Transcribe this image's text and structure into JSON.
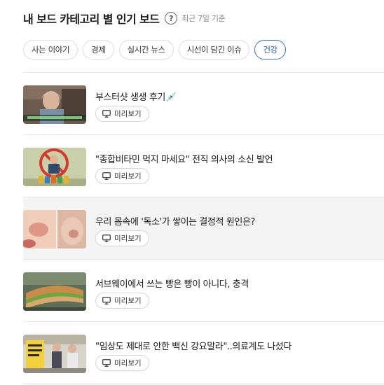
{
  "header": {
    "title": "내 보드 카테고리 별 인기 보드",
    "help_glyph": "?",
    "subtitle": "최근 7일 기준"
  },
  "tabs": [
    {
      "label": "사는 이야기",
      "active": false
    },
    {
      "label": "경제",
      "active": false
    },
    {
      "label": "실시간 뉴스",
      "active": false
    },
    {
      "label": "시선이 담긴 이슈",
      "active": false
    },
    {
      "label": "건강",
      "active": true
    }
  ],
  "items": [
    {
      "title": "부스터샷 생생 후기💉",
      "preview_label": "미리보기",
      "thumb_icon": "elderly-woman-tv-thumbnail"
    },
    {
      "title": "\"종합비타민 먹지 마세요\" 전직 의사의 소신 발언",
      "preview_label": "미리보기",
      "thumb_icon": "no-vitamins-thumbnail"
    },
    {
      "title": "우리 몸속에 '독소'가 쌓이는 결정적 원인은?",
      "preview_label": "미리보기",
      "thumb_icon": "skin-rash-thumbnail"
    },
    {
      "title": "서브웨이에서 쓰는 빵은 빵이 아니다, 충격",
      "preview_label": "미리보기",
      "thumb_icon": "sandwich-thumbnail"
    },
    {
      "title": "\"임상도 제대로 안한 백신 강요말라\"..의료계도 나섰다",
      "preview_label": "미리보기",
      "thumb_icon": "protest-thumbnail"
    }
  ],
  "colors": {
    "accent": "#2a5bd7",
    "highlight_row": "#f4f4f4"
  }
}
